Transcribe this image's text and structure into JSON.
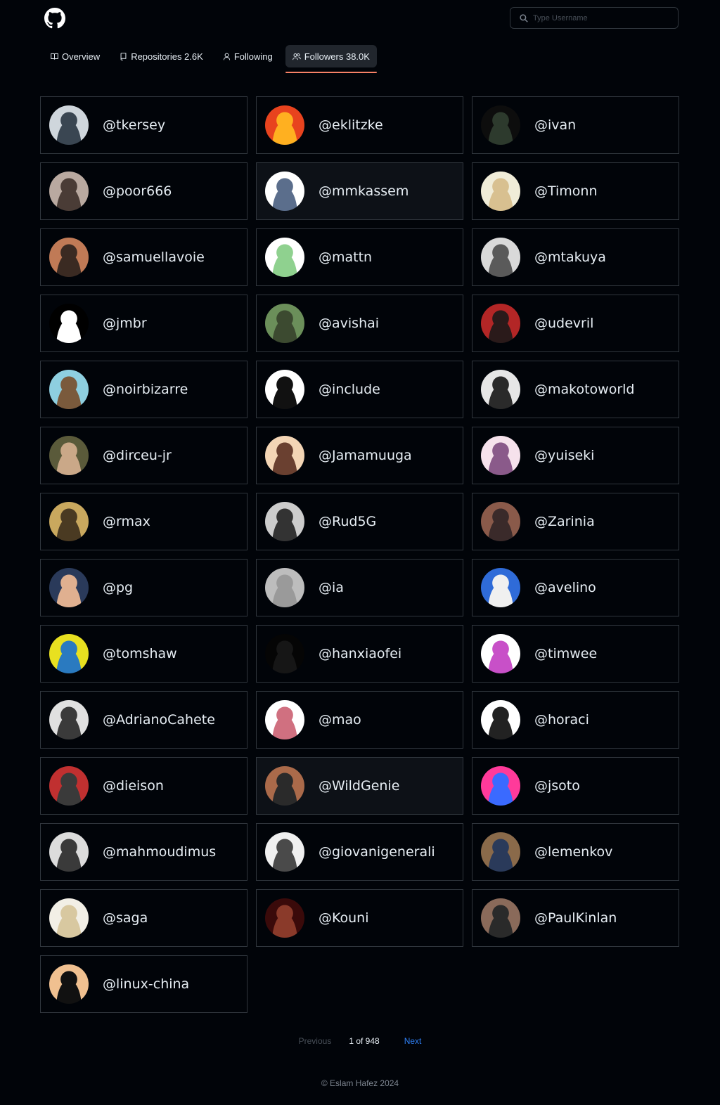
{
  "search": {
    "placeholder": "Type Username"
  },
  "tabs": [
    {
      "label": "Overview",
      "icon": "book-icon",
      "active": false
    },
    {
      "label": "Repositories 2.6K",
      "icon": "repo-icon",
      "active": false
    },
    {
      "label": "Following",
      "icon": "person-icon",
      "active": false
    },
    {
      "label": "Followers 38.0K",
      "icon": "people-icon",
      "active": true
    }
  ],
  "followers": [
    {
      "username": "@tkersey",
      "colors": [
        "#cfd6dc",
        "#3a4652"
      ]
    },
    {
      "username": "@eklitzke",
      "colors": [
        "#e8431e",
        "#ffb020"
      ]
    },
    {
      "username": "@ivan",
      "colors": [
        "#0d0d0d",
        "#2d3a2d"
      ]
    },
    {
      "username": "@poor666",
      "colors": [
        "#b9a9a0",
        "#4a3c36"
      ]
    },
    {
      "username": "@mmkassem",
      "colors": [
        "#ffffff",
        "#5b6e8c"
      ]
    },
    {
      "username": "@Timonn",
      "colors": [
        "#f0ecd8",
        "#d8c090"
      ]
    },
    {
      "username": "@samuellavoie",
      "colors": [
        "#c07a56",
        "#3a2a22"
      ]
    },
    {
      "username": "@mattn",
      "colors": [
        "#ffffff",
        "#8fd18f"
      ]
    },
    {
      "username": "@mtakuya",
      "colors": [
        "#d9d9d9",
        "#5a5a5a"
      ]
    },
    {
      "username": "@jmbr",
      "colors": [
        "#000000",
        "#ffffff"
      ]
    },
    {
      "username": "@avishai",
      "colors": [
        "#6b8f5a",
        "#3c4a30"
      ]
    },
    {
      "username": "@udevril",
      "colors": [
        "#b32626",
        "#2a1a1a"
      ]
    },
    {
      "username": "@noirbizarre",
      "colors": [
        "#8ecfe0",
        "#7a5a3c"
      ]
    },
    {
      "username": "@include",
      "colors": [
        "#ffffff",
        "#111111"
      ]
    },
    {
      "username": "@makotoworld",
      "colors": [
        "#e6e6e6",
        "#2a2a2a"
      ]
    },
    {
      "username": "@dirceu-jr",
      "colors": [
        "#5a5a3a",
        "#caa888"
      ]
    },
    {
      "username": "@Jamamuuga",
      "colors": [
        "#f3d5b5",
        "#6a4030"
      ]
    },
    {
      "username": "@yuiseki",
      "colors": [
        "#f6e2ec",
        "#8a5a8a"
      ]
    },
    {
      "username": "@rmax",
      "colors": [
        "#c9a85e",
        "#4a3a22"
      ]
    },
    {
      "username": "@Rud5G",
      "colors": [
        "#cccccc",
        "#333333"
      ]
    },
    {
      "username": "@Zarinia",
      "colors": [
        "#8a5a4a",
        "#3a2a2a"
      ]
    },
    {
      "username": "@pg",
      "colors": [
        "#2a3a5a",
        "#e0b090"
      ]
    },
    {
      "username": "@ia",
      "colors": [
        "#bdbdbd",
        "#9a9a9a"
      ]
    },
    {
      "username": "@avelino",
      "colors": [
        "#2f6bd8",
        "#f0f0f0"
      ]
    },
    {
      "username": "@tomshaw",
      "colors": [
        "#e8e020",
        "#2a7ac0"
      ]
    },
    {
      "username": "@hanxiaofei",
      "colors": [
        "#050505",
        "#161616"
      ]
    },
    {
      "username": "@timwee",
      "colors": [
        "#ffffff",
        "#c850c8"
      ]
    },
    {
      "username": "@AdrianoCahete",
      "colors": [
        "#e0e0e0",
        "#3a3a3a"
      ]
    },
    {
      "username": "@mao",
      "colors": [
        "#ffffff",
        "#d07080"
      ]
    },
    {
      "username": "@horaci",
      "colors": [
        "#ffffff",
        "#222222"
      ]
    },
    {
      "username": "@dieison",
      "colors": [
        "#c03030",
        "#3a3a3a"
      ]
    },
    {
      "username": "@WildGenie",
      "colors": [
        "#aa6a4a",
        "#2a2a2a"
      ]
    },
    {
      "username": "@jsoto",
      "colors": [
        "#ff3a9a",
        "#3a6aff"
      ]
    },
    {
      "username": "@mahmoudimus",
      "colors": [
        "#dcdcdc",
        "#3a3a3a"
      ]
    },
    {
      "username": "@giovanigenerali",
      "colors": [
        "#f0f0f0",
        "#4a4a4a"
      ]
    },
    {
      "username": "@lemenkov",
      "colors": [
        "#8a6a4a",
        "#2a3a5a"
      ]
    },
    {
      "username": "@saga",
      "colors": [
        "#f2efe6",
        "#d8c8a0"
      ]
    },
    {
      "username": "@Kouni",
      "colors": [
        "#3a0a0a",
        "#8a3a2a"
      ]
    },
    {
      "username": "@PaulKinlan",
      "colors": [
        "#8a6a5a",
        "#2a2a2a"
      ]
    },
    {
      "username": "@linux-china",
      "colors": [
        "#f0c090",
        "#111111"
      ]
    }
  ],
  "pagination": {
    "prev_label": "Previous",
    "page_label": "1 of 948",
    "next_label": "Next"
  },
  "footer": {
    "text": "© Eslam Hafez 2024"
  }
}
